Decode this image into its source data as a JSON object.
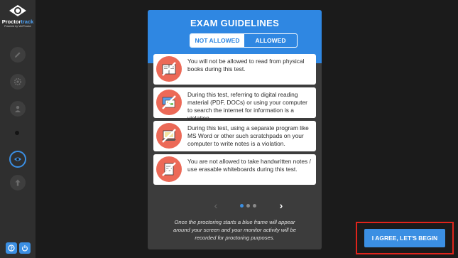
{
  "brand": {
    "name_part1": "Proctor",
    "name_part2": "track",
    "tagline": "Powered by VeriProctor"
  },
  "modal": {
    "title": "EXAM GUIDELINES",
    "tabs": {
      "not_allowed": "NOT ALLOWED",
      "allowed": "ALLOWED",
      "active": "not_allowed"
    },
    "items": [
      {
        "icon": "book-icon",
        "text": "You will not be allowed to read from physical books during this test."
      },
      {
        "icon": "digital-material-icon",
        "text": "During this test, referring to digital reading material (PDF, DOCs) or using your computer to search the internet for information is a violation."
      },
      {
        "icon": "laptop-icon",
        "text": "During this test, using a separate program like MS Word or other such scratchpads on your computer to write notes is a violation."
      },
      {
        "icon": "handwritten-notes-icon",
        "text": "You are not allowed to take handwritten notes / use erasable whiteboards during this test."
      }
    ],
    "pager": {
      "page": 1,
      "total": 3
    },
    "footer_note": "Once the proctoring starts a blue frame will appear around your screen and your monitor activity will be recorded for proctoring purposes."
  },
  "agree_button": "I AGREE, LET'S BEGIN",
  "colors": {
    "accent": "#2f87e2",
    "button": "#3b8fe3",
    "icon_circle": "#ec6957",
    "highlight_frame": "#e0241b"
  }
}
